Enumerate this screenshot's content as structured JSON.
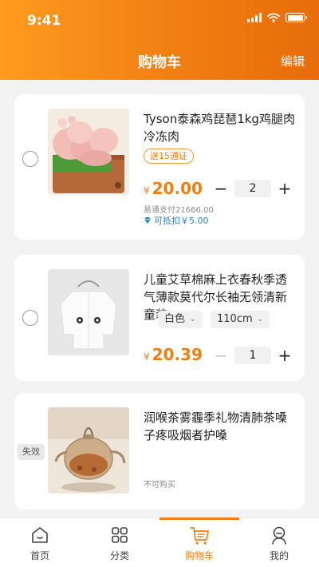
{
  "status_bar": {
    "time": "9:41"
  },
  "nav": {
    "title": "购物车",
    "edit_label": "编辑"
  },
  "cart": [
    {
      "title": "Tyson泰森鸡琵琶1kg鸡腿肉冷冻肉",
      "coupon": "送15通证",
      "currency": "¥",
      "price": "20.00",
      "quantity": "2",
      "note": "易通支付21666.00",
      "deduct": "可抵扣￥5.00",
      "selected": false
    },
    {
      "title": "儿童艾草棉麻上衣春秋季透气薄款莫代尔长袖无领清新童装",
      "spec_color": "白色",
      "spec_size": "110cm",
      "currency": "¥",
      "price": "20.39",
      "quantity": "1",
      "selected": false
    },
    {
      "title": "润喉茶雾霾季礼物清肺茶嗓子疼吸烟者护嗓",
      "invalid_tag": "失效",
      "unavailable": "不可购买"
    }
  ],
  "tabbar": [
    {
      "label": "首页",
      "icon": "home-icon"
    },
    {
      "label": "分类",
      "icon": "category-icon"
    },
    {
      "label": "购物车",
      "icon": "cart-icon",
      "active": true
    },
    {
      "label": "我的",
      "icon": "profile-icon"
    }
  ],
  "colors": {
    "accent": "#f07f12",
    "header_start": "#ff9a1f",
    "header_end": "#e86c0b",
    "link_blue": "#2f7fc9"
  }
}
